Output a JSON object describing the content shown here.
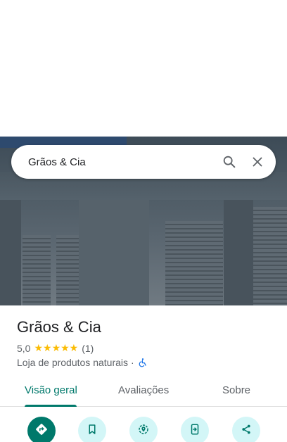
{
  "search": {
    "query": "Grãos & Cia"
  },
  "place": {
    "name": "Grãos & Cia",
    "rating": "5,0",
    "stars": "★★★★★",
    "review_count": "(1)",
    "category": "Loja de produtos naturais",
    "separator": "·"
  },
  "tabs": [
    {
      "label": "Visão geral",
      "active": true
    },
    {
      "label": "Avaliações",
      "active": false
    },
    {
      "label": "Sobre",
      "active": false
    }
  ],
  "actions": [
    {
      "icon": "directions-icon"
    },
    {
      "icon": "bookmark-icon"
    },
    {
      "icon": "nearby-icon"
    },
    {
      "icon": "send-to-phone-icon"
    },
    {
      "icon": "share-icon"
    }
  ],
  "colors": {
    "accent": "#00796b",
    "star": "#fbbc04",
    "action_bg": "#d3f6f7",
    "access_blue": "#1a73e8"
  }
}
